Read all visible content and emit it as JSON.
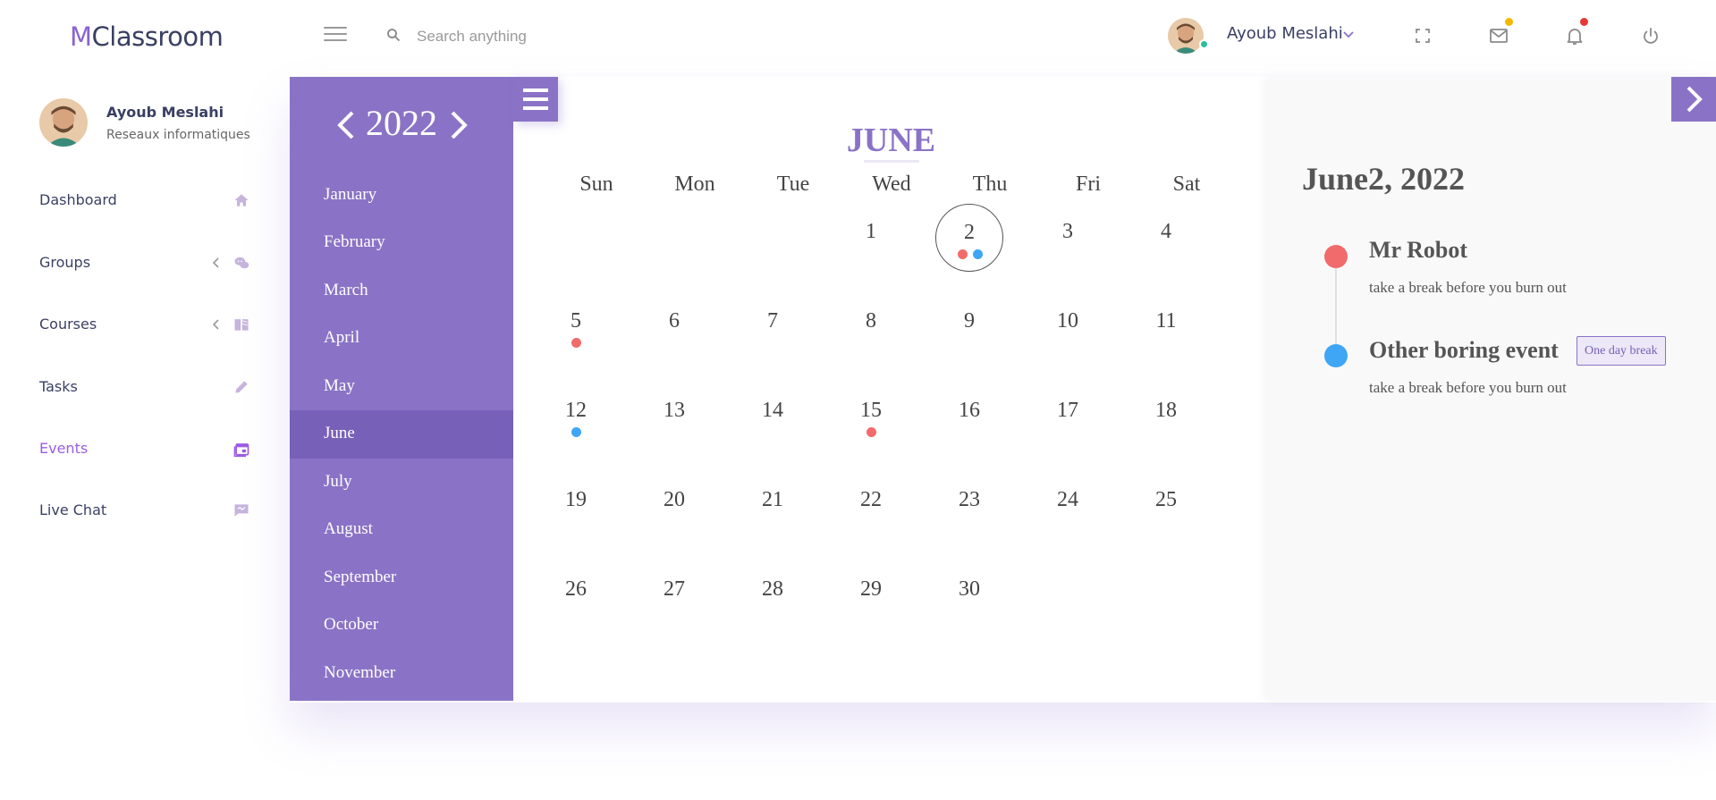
{
  "app": {
    "logo_first": "M",
    "logo_rest": "Classroom"
  },
  "header": {
    "search_placeholder": "Search anything",
    "username": "Ayoub Meslahi",
    "icons": [
      "menu-icon",
      "search-icon",
      "fullscreen-icon",
      "mail-icon",
      "bell-icon",
      "power-icon"
    ],
    "mail_badge_color": "#f5b800",
    "bell_badge_color": "#e53935"
  },
  "sidebar": {
    "profile": {
      "name": "Ayoub Meslahi",
      "role": "Reseaux informatiques"
    },
    "items": [
      {
        "label": "Dashboard",
        "icon": "home-icon",
        "caret": false,
        "active": false
      },
      {
        "label": "Groups",
        "icon": "chat-group-icon",
        "caret": true,
        "active": false
      },
      {
        "label": "Courses",
        "icon": "book-icon",
        "caret": true,
        "active": false
      },
      {
        "label": "Tasks",
        "icon": "pencil-icon",
        "caret": false,
        "active": false
      },
      {
        "label": "Events",
        "icon": "calendar-icon",
        "caret": false,
        "active": true
      },
      {
        "label": "Live Chat",
        "icon": "message-icon",
        "caret": false,
        "active": false
      }
    ]
  },
  "months_panel": {
    "year": "2022",
    "months": [
      "January",
      "February",
      "March",
      "April",
      "May",
      "June",
      "July",
      "August",
      "September",
      "October",
      "November"
    ],
    "selected": "June"
  },
  "calendar": {
    "month": "JUNE",
    "weekdays": [
      "Sun",
      "Mon",
      "Tue",
      "Wed",
      "Thu",
      "Fri",
      "Sat"
    ],
    "first_weekday_index": 3,
    "days_in_month": 30,
    "selected_day": 2,
    "event_dots": {
      "2": [
        "#f26b6b",
        "#3ea6f5"
      ],
      "5": [
        "#f26b6b"
      ],
      "12": [
        "#3ea6f5"
      ],
      "15": [
        "#f26b6b"
      ]
    }
  },
  "events": {
    "date_heading": "June2, 2022",
    "items": [
      {
        "title": "Mr Robot",
        "desc": "take a break before you burn out",
        "color": "#f26b6b",
        "tag": ""
      },
      {
        "title": "Other boring event",
        "desc": "take a break before you burn out",
        "color": "#3ea6f5",
        "tag": "One day break"
      }
    ]
  },
  "colors": {
    "accent": "#8a73c6",
    "accent_dark": "#7760b8",
    "active_nav": "#9b5de5"
  }
}
